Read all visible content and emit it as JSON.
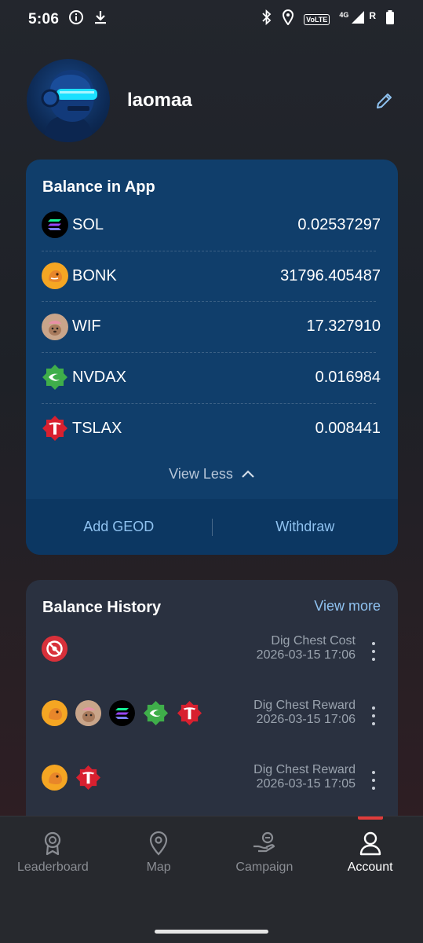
{
  "status_bar": {
    "time": "5:06",
    "volte": "VoLTE",
    "network": "4G",
    "roaming": "R"
  },
  "profile": {
    "username": "laomaa"
  },
  "balance": {
    "title": "Balance in App",
    "tokens": [
      {
        "symbol": "SOL",
        "amount": "0.02537297",
        "icon": "solana-icon",
        "color": "#000000"
      },
      {
        "symbol": "BONK",
        "amount": "31796.405487",
        "icon": "bonk-icon",
        "color": "#f5a623"
      },
      {
        "symbol": "WIF",
        "amount": "17.327910",
        "icon": "wif-icon",
        "color": "#b58e73"
      },
      {
        "symbol": "NVDAX",
        "amount": "0.016984",
        "icon": "nvidia-icon",
        "color": "#4caf50"
      },
      {
        "symbol": "TSLAX",
        "amount": "0.008441",
        "icon": "tesla-icon",
        "color": "#e31937"
      }
    ],
    "view_less_label": "View Less",
    "add_label": "Add GEOD",
    "withdraw_label": "Withdraw"
  },
  "history": {
    "title": "Balance History",
    "view_more_label": "View more",
    "entries": [
      {
        "label": "Dig Chest Cost",
        "timestamp": "2026-03-15 17:06",
        "icons": [
          "geod-cost-icon"
        ]
      },
      {
        "label": "Dig Chest Reward",
        "timestamp": "2026-03-15 17:06",
        "icons": [
          "bonk-icon",
          "wif-icon",
          "solana-icon",
          "nvidia-icon",
          "tesla-icon"
        ]
      },
      {
        "label": "Dig Chest Reward",
        "timestamp": "2026-03-15 17:05",
        "icons": [
          "bonk-icon",
          "tesla-icon"
        ]
      }
    ]
  },
  "nav": {
    "items": [
      {
        "label": "Leaderboard",
        "icon": "award-icon",
        "active": false
      },
      {
        "label": "Map",
        "icon": "map-pin-icon",
        "active": false
      },
      {
        "label": "Campaign",
        "icon": "campaign-icon",
        "active": false
      },
      {
        "label": "Account",
        "icon": "user-icon",
        "active": true
      }
    ],
    "active_color": "#e03c3c"
  }
}
